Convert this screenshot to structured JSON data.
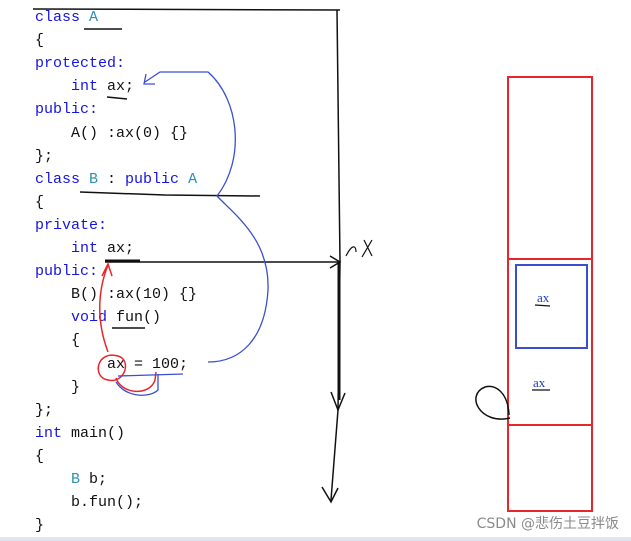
{
  "code_lines": [
    [
      {
        "t": "class ",
        "c": "kw"
      },
      {
        "t": "A",
        "c": "ty"
      }
    ],
    [
      {
        "t": "{",
        "c": "tx"
      }
    ],
    [
      {
        "t": "protected:",
        "c": "kw"
      }
    ],
    [
      {
        "t": "    ",
        "c": "tx"
      },
      {
        "t": "int",
        "c": "kw"
      },
      {
        "t": " ax;",
        "c": "tx"
      }
    ],
    [
      {
        "t": "public:",
        "c": "kw"
      }
    ],
    [
      {
        "t": "    A() :ax(0) {}",
        "c": "tx"
      }
    ],
    [
      {
        "t": "};",
        "c": "tx"
      }
    ],
    [
      {
        "t": "class ",
        "c": "kw"
      },
      {
        "t": "B",
        "c": "ty"
      },
      {
        "t": " : ",
        "c": "tx"
      },
      {
        "t": "public ",
        "c": "kw"
      },
      {
        "t": "A",
        "c": "ty"
      }
    ],
    [
      {
        "t": "{",
        "c": "tx"
      }
    ],
    [
      {
        "t": "private:",
        "c": "kw"
      }
    ],
    [
      {
        "t": "    ",
        "c": "tx"
      },
      {
        "t": "int",
        "c": "kw"
      },
      {
        "t": " ax;",
        "c": "tx"
      }
    ],
    [
      {
        "t": "public:",
        "c": "kw"
      }
    ],
    [
      {
        "t": "    B() :ax(10) {}",
        "c": "tx"
      }
    ],
    [
      {
        "t": "    ",
        "c": "tx"
      },
      {
        "t": "void",
        "c": "kw"
      },
      {
        "t": " fun()",
        "c": "tx"
      }
    ],
    [
      {
        "t": "    {",
        "c": "tx"
      }
    ],
    [
      {
        "t": "        ax = 100;",
        "c": "tx"
      }
    ],
    [
      {
        "t": "    }",
        "c": "tx"
      }
    ],
    [
      {
        "t": "};",
        "c": "tx"
      }
    ],
    [
      {
        "t": "int",
        "c": "kw"
      },
      {
        "t": " main()",
        "c": "tx"
      }
    ],
    [
      {
        "t": "{",
        "c": "tx"
      }
    ],
    [
      {
        "t": "    ",
        "c": "tx"
      },
      {
        "t": "B",
        "c": "ty"
      },
      {
        "t": " b;",
        "c": "tx"
      }
    ],
    [
      {
        "t": "    b.fun();",
        "c": "tx"
      }
    ],
    [
      {
        "t": "}",
        "c": "tx"
      }
    ]
  ],
  "diagram": {
    "axis_label": "ax",
    "inner_box_label": "ax",
    "outer_label": "ax",
    "colors": {
      "red": "#e8262a",
      "blue": "#3a4fd0",
      "ink": "#111111"
    }
  },
  "watermark": "CSDN @悲伤土豆拌饭"
}
